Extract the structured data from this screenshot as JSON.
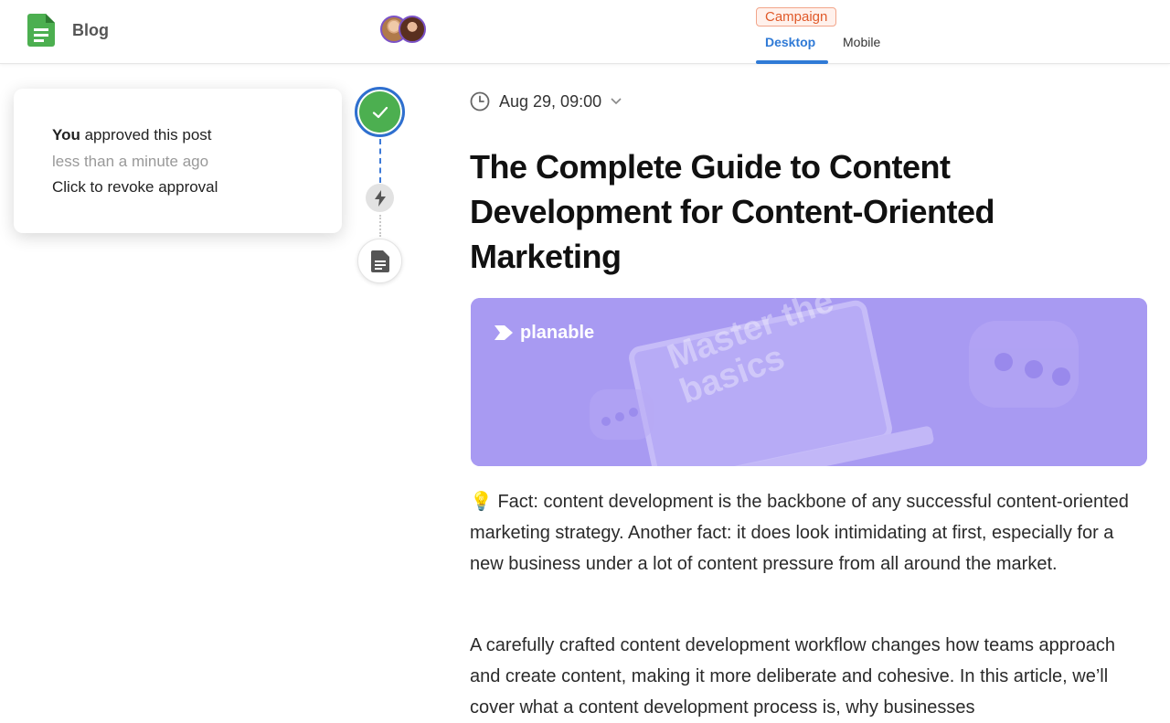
{
  "header": {
    "app_title": "Blog",
    "campaign_label": "Campaign",
    "tabs": [
      {
        "label": "Desktop",
        "active": true
      },
      {
        "label": "Mobile",
        "active": false
      }
    ],
    "accent_color": "#2f7ad6"
  },
  "approval": {
    "actor": "You",
    "action": "approved this post",
    "time": "less than a minute ago",
    "revoke": "Click to revoke approval",
    "status_color": "#4caf50"
  },
  "timeline": {
    "icons": [
      "check-icon",
      "bolt-icon",
      "document-icon"
    ]
  },
  "post": {
    "schedule": "Aug 29, 09:00",
    "title": "The Complete Guide to Content Development for Content-Oriented Marketing",
    "hero": {
      "brand": "planable",
      "overlay_text": "Master the basics"
    },
    "paragraphs": [
      "💡 Fact: content development is the backbone of any successful content-oriented marketing strategy. Another fact: it does look intimidating at first, especially for a new business under a lot of content pressure from all around the market.",
      "A carefully crafted content development workflow changes how teams approach and create content, making it more deliberate and cohesive. In this article, we’ll cover what a content development process is, why businesses"
    ]
  }
}
